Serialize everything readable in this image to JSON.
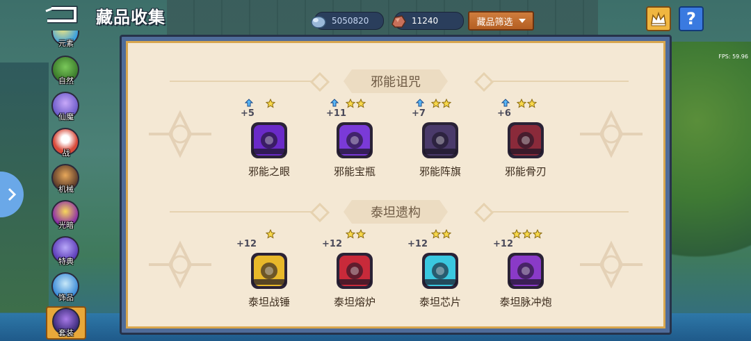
{
  "header": {
    "title": "藏品收集",
    "gems": "5050820",
    "ore": "11240",
    "filter_label": "藏品筛选",
    "help_label": "?"
  },
  "fps": "FPS: 59.96",
  "sidebar": {
    "items": [
      {
        "label": "元素",
        "color": "#3aa0e0",
        "icon": "element-icon"
      },
      {
        "label": "自然",
        "color": "#4a9e3a",
        "icon": "tree-icon"
      },
      {
        "label": "仙魔",
        "color": "#6a5ac8",
        "icon": "demon-icon"
      },
      {
        "label": "战",
        "color": "#d84a3a",
        "icon": "fire-icon"
      },
      {
        "label": "机械",
        "color": "#8a5a3a",
        "icon": "mech-icon"
      },
      {
        "label": "光暗",
        "color": "#c83aa8",
        "icon": "light-dark-icon"
      },
      {
        "label": "特典",
        "color": "#6a4ac8",
        "icon": "special-icon"
      },
      {
        "label": "饰品",
        "color": "#4a9ad8",
        "icon": "ornament-icon"
      },
      {
        "label": "套装",
        "color": "#5a3a9a",
        "icon": "set-icon",
        "active": true
      }
    ]
  },
  "sections": [
    {
      "title": "邪能诅咒",
      "items": [
        {
          "name": "邪能之眼",
          "plus": "+5",
          "stars": 1,
          "upgrade": true,
          "color": "#6a2ac8",
          "icon": "fel-eye-icon"
        },
        {
          "name": "邪能宝瓶",
          "plus": "+11",
          "stars": 2,
          "upgrade": true,
          "color": "#7a3ad8",
          "icon": "fel-vase-icon"
        },
        {
          "name": "邪能阵旗",
          "plus": "+7",
          "stars": 2,
          "upgrade": true,
          "color": "#4a3a6a",
          "icon": "fel-banner-icon"
        },
        {
          "name": "邪能骨刃",
          "plus": "+6",
          "stars": 2,
          "upgrade": true,
          "color": "#8a2a3a",
          "icon": "fel-bone-blade-icon"
        }
      ]
    },
    {
      "title": "泰坦遗构",
      "items": [
        {
          "name": "泰坦战锤",
          "plus": "+12",
          "stars": 1,
          "upgrade": false,
          "color": "#e8b82a",
          "icon": "titan-hammer-icon"
        },
        {
          "name": "泰坦熔炉",
          "plus": "+12",
          "stars": 2,
          "upgrade": false,
          "color": "#c82a3a",
          "icon": "titan-furnace-icon"
        },
        {
          "name": "泰坦芯片",
          "plus": "+12",
          "stars": 2,
          "upgrade": false,
          "color": "#3ac8e0",
          "icon": "titan-chip-icon"
        },
        {
          "name": "泰坦脉冲炮",
          "plus": "+12",
          "stars": 3,
          "upgrade": false,
          "color": "#8a3ac8",
          "icon": "titan-pulse-cannon-icon"
        }
      ]
    }
  ]
}
